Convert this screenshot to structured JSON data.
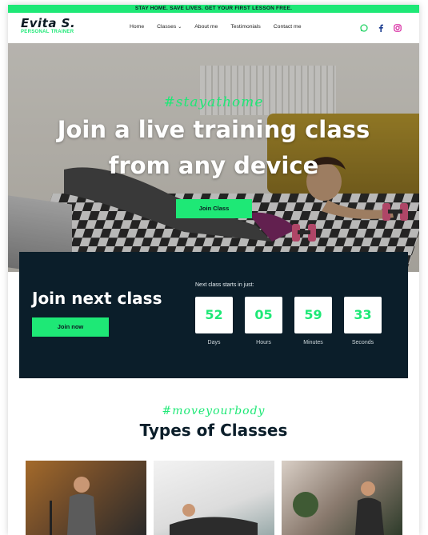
{
  "topbar": {
    "text": "STAY HOME. SAVE LIVES. GET YOUR FIRST LESSON FREE."
  },
  "brand": {
    "name": "Evita S.",
    "tagline": "PERSONAL TRAINER"
  },
  "nav": {
    "items": [
      "Home",
      "Classes",
      "About me",
      "Testimonials",
      "Contact me"
    ]
  },
  "social": {
    "icons": [
      "whatsapp-icon",
      "facebook-icon",
      "instagram-icon"
    ]
  },
  "hero": {
    "hashtag": "#stayathome",
    "headline_line1": "Join a live training class",
    "headline_line2": "from any device",
    "button": "Join Class"
  },
  "countdown": {
    "title": "Join next class",
    "button": "Join now",
    "label": "Next class starts in just:",
    "units": [
      {
        "value": "52",
        "label": "Days"
      },
      {
        "value": "05",
        "label": "Hours"
      },
      {
        "value": "59",
        "label": "Minutes"
      },
      {
        "value": "33",
        "label": "Seconds"
      }
    ]
  },
  "types": {
    "hashtag": "#moveyourbody",
    "title": "Types of Classes"
  },
  "colors": {
    "accent": "#1ee876",
    "dark": "#0b1e2a"
  }
}
